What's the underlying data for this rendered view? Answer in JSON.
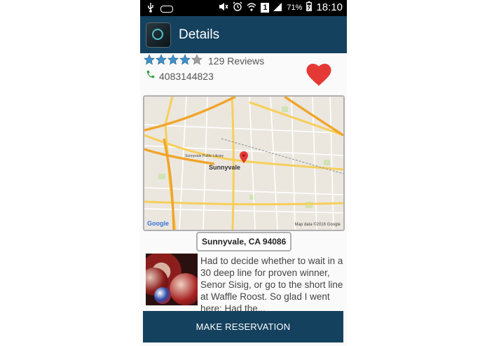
{
  "status_bar": {
    "icons": [
      "usb-icon",
      "voicemail-icon",
      "mute-icon",
      "alarm-icon",
      "wifi-icon",
      "sim-1-icon",
      "signal-icon",
      "battery-icon"
    ],
    "sim_label": "1",
    "battery": "71%",
    "time": "18:10"
  },
  "appbar": {
    "title": "Details",
    "color": "#14415e"
  },
  "rating": {
    "stars_filled": 4,
    "stars_total": 5,
    "reviews": "129 Reviews",
    "star_color": "#3f90c6"
  },
  "contact": {
    "phone": "4083144823",
    "phone_icon_color": "#3aa04a"
  },
  "favorite": {
    "icon": "heart-icon",
    "color": "#e53935"
  },
  "map": {
    "city": "Sunnyvale",
    "library_label": "Sunnyvale Public Library",
    "google_label": "Google",
    "credit": "Map data ©2016 Google"
  },
  "address": "Sunnyvale, CA 94086",
  "review": {
    "text": "Had to decide whether to wait in a 30 deep line for proven winner, Senor Sisig, or go to the short line at Waffle Roost.   So glad I went here:   Had the..."
  },
  "actions": {
    "reserve_label": "MAKE RESERVATION"
  }
}
